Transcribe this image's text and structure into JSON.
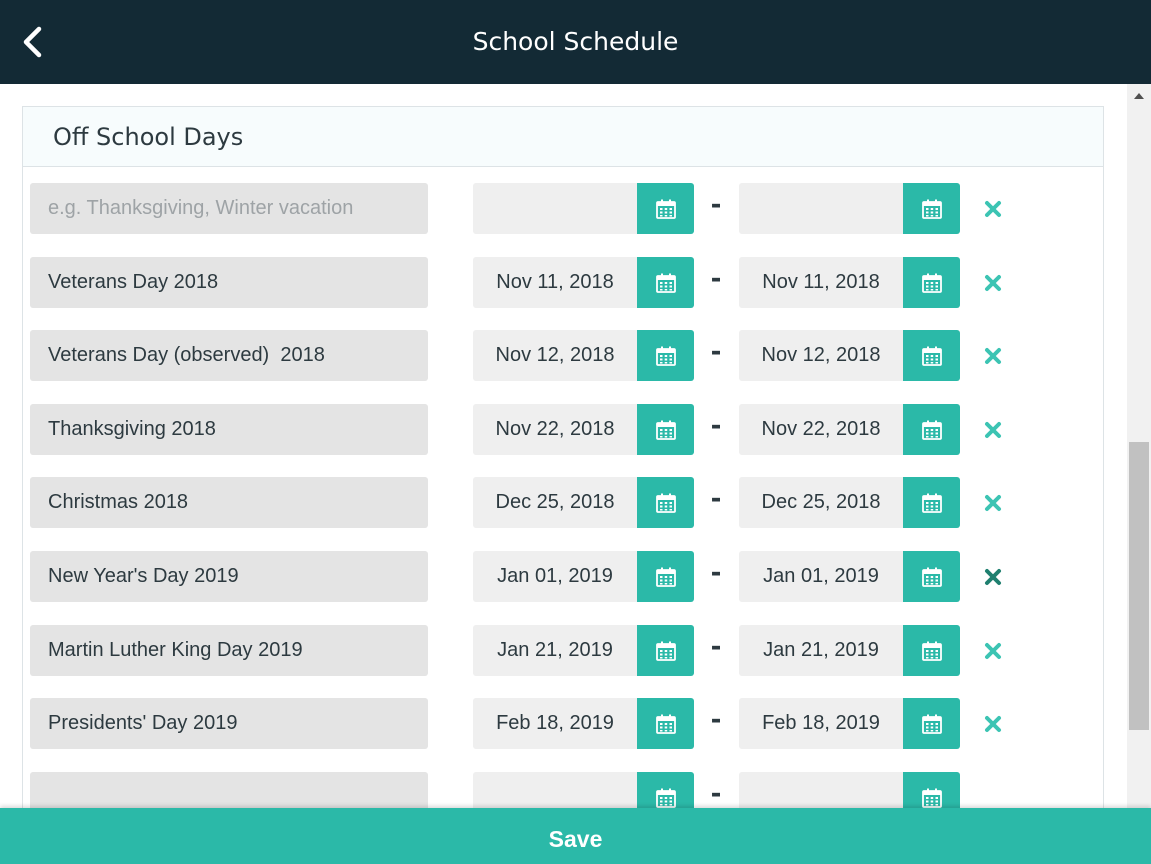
{
  "header": {
    "title": "School Schedule",
    "back_icon": "chevron-left-icon"
  },
  "section": {
    "title": "Off School Days"
  },
  "new_entry": {
    "name_placeholder": "e.g. Thanksgiving, Winter vacation",
    "from_value": "",
    "to_value": ""
  },
  "range_separator": "-",
  "entries": [
    {
      "name": "Veterans Day 2018",
      "from": "Nov 11, 2018",
      "to": "Nov 11, 2018"
    },
    {
      "name": "Veterans Day (observed)  2018",
      "from": "Nov 12, 2018",
      "to": "Nov 12, 2018"
    },
    {
      "name": "Thanksgiving 2018",
      "from": "Nov 22, 2018",
      "to": "Nov 22, 2018"
    },
    {
      "name": "Christmas 2018",
      "from": "Dec 25, 2018",
      "to": "Dec 25, 2018"
    },
    {
      "name": "New Year's Day 2019",
      "from": "Jan 01, 2019",
      "to": "Jan 01, 2019"
    },
    {
      "name": "Martin Luther King Day 2019",
      "from": "Jan 21, 2019",
      "to": "Jan 21, 2019"
    },
    {
      "name": "Presidents' Day 2019",
      "from": "Feb 18, 2019",
      "to": "Feb 18, 2019"
    },
    {
      "name": "",
      "from": "",
      "to": ""
    }
  ],
  "icons": {
    "calendar": "calendar-icon",
    "remove": "close-icon"
  },
  "footer": {
    "save_label": "Save"
  },
  "colors": {
    "header_bg": "#132a35",
    "accent": "#2bb9a8",
    "remove_icon": "#3cc4b3",
    "remove_icon_hover": "#1f7f6f",
    "field_bg": "#e4e4e4"
  }
}
